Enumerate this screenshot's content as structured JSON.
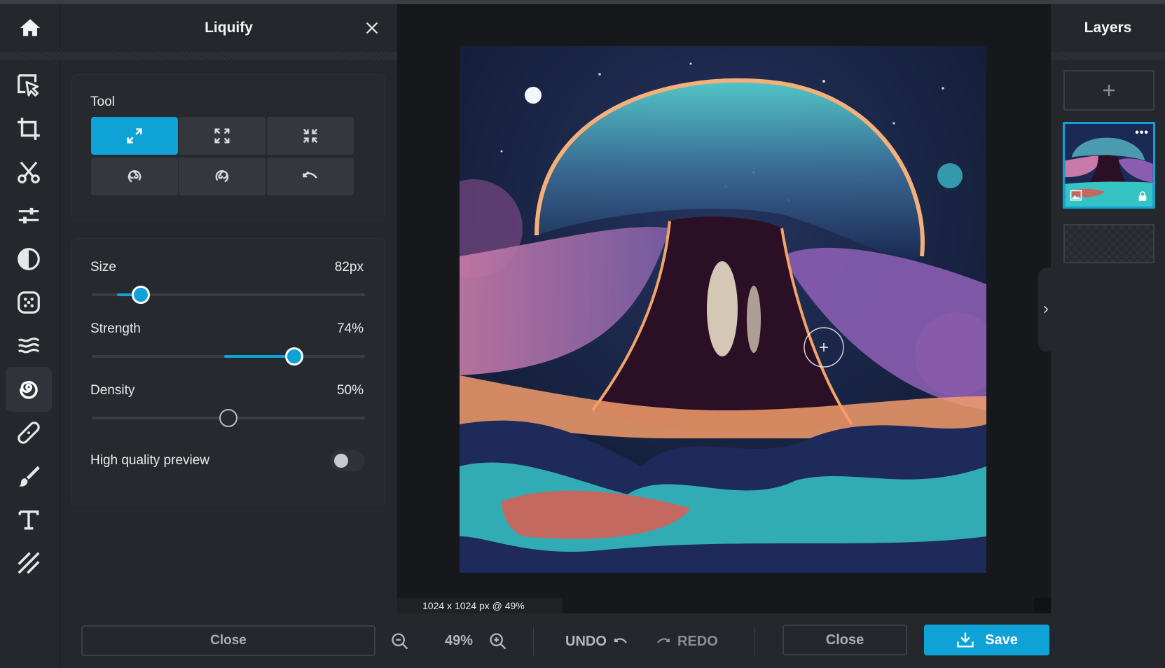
{
  "panel": {
    "title": "Liquify",
    "tool_label": "Tool",
    "sliders": [
      {
        "label": "Size",
        "value_text": "82px",
        "fraction": 0.18
      },
      {
        "label": "Strength",
        "value_text": "74%",
        "fraction": 0.74
      },
      {
        "label": "Density",
        "value_text": "50%",
        "fraction": 0.5
      }
    ],
    "hq_preview_label": "High quality preview",
    "hq_preview_on": false,
    "close_label": "Close"
  },
  "canvas": {
    "dimensions": "1024 x 1024 px @ 49%"
  },
  "toolbar": {
    "zoom": "49%",
    "undo_label": "UNDO",
    "redo_label": "REDO",
    "close_label": "Close",
    "save_label": "Save"
  },
  "layers": {
    "title": "Layers"
  },
  "colors": {
    "accent": "#0ea2d6",
    "panel": "#24272b",
    "canvas_bg": "#16181b"
  }
}
